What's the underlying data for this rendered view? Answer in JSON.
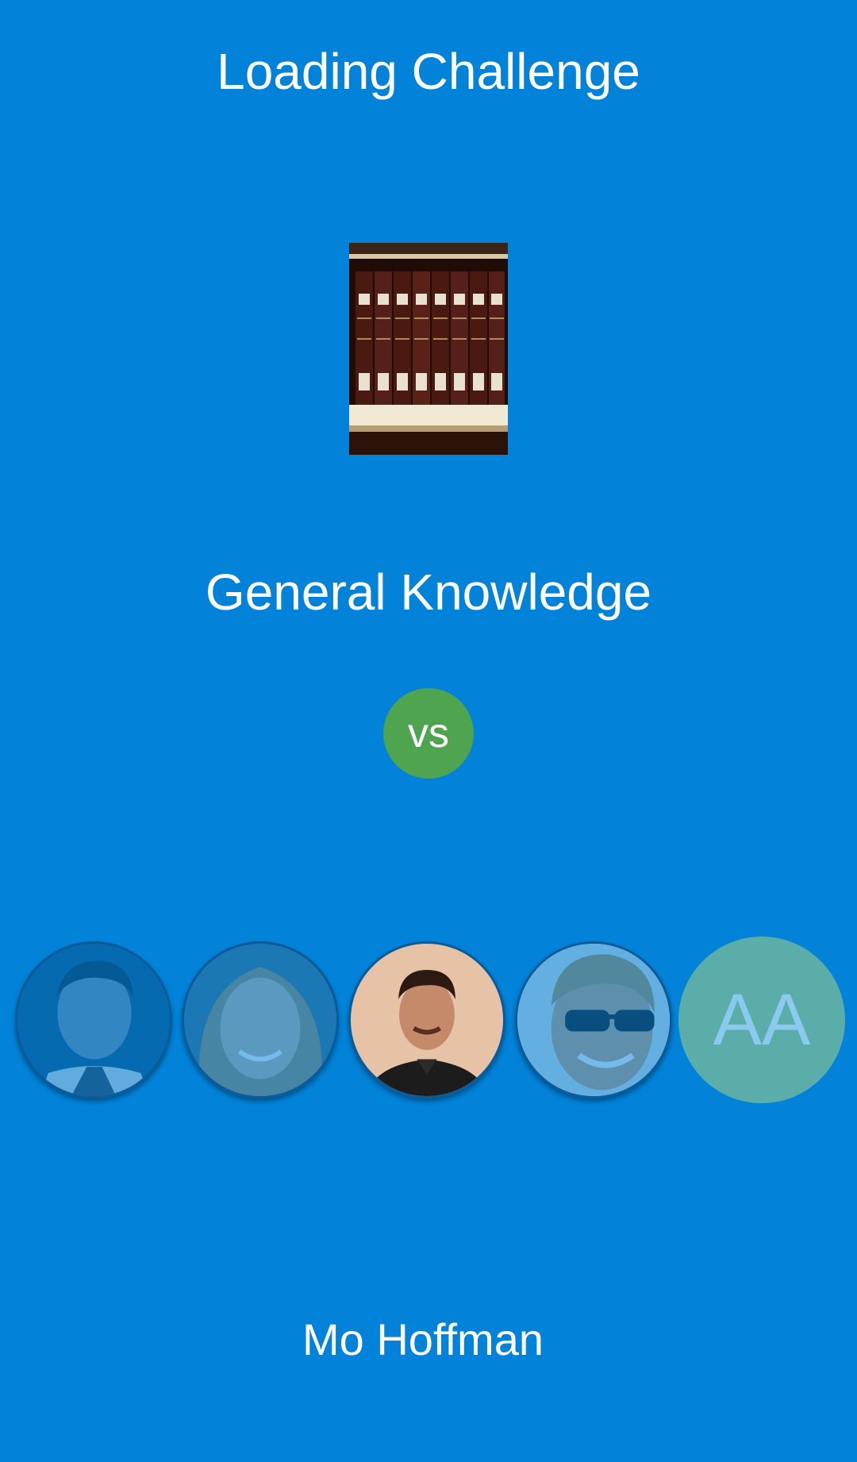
{
  "screen": {
    "title": "Loading Challenge",
    "category_name": "General Knowledge",
    "vs_label": "vs",
    "player_name": "Mo Hoffman",
    "colors": {
      "background": "#0282d8",
      "vs_badge": "#4ea44f",
      "initials_avatar": "#5aada8"
    }
  },
  "category_image": {
    "icon": "encyclopedia-books-image"
  },
  "opponents": [
    {
      "icon": "avatar-photo",
      "dimmed": true
    },
    {
      "icon": "avatar-photo",
      "dimmed": true
    },
    {
      "icon": "avatar-photo",
      "dimmed": false
    },
    {
      "icon": "avatar-photo",
      "dimmed": true
    },
    {
      "initials": "AA",
      "dimmed": true
    }
  ]
}
